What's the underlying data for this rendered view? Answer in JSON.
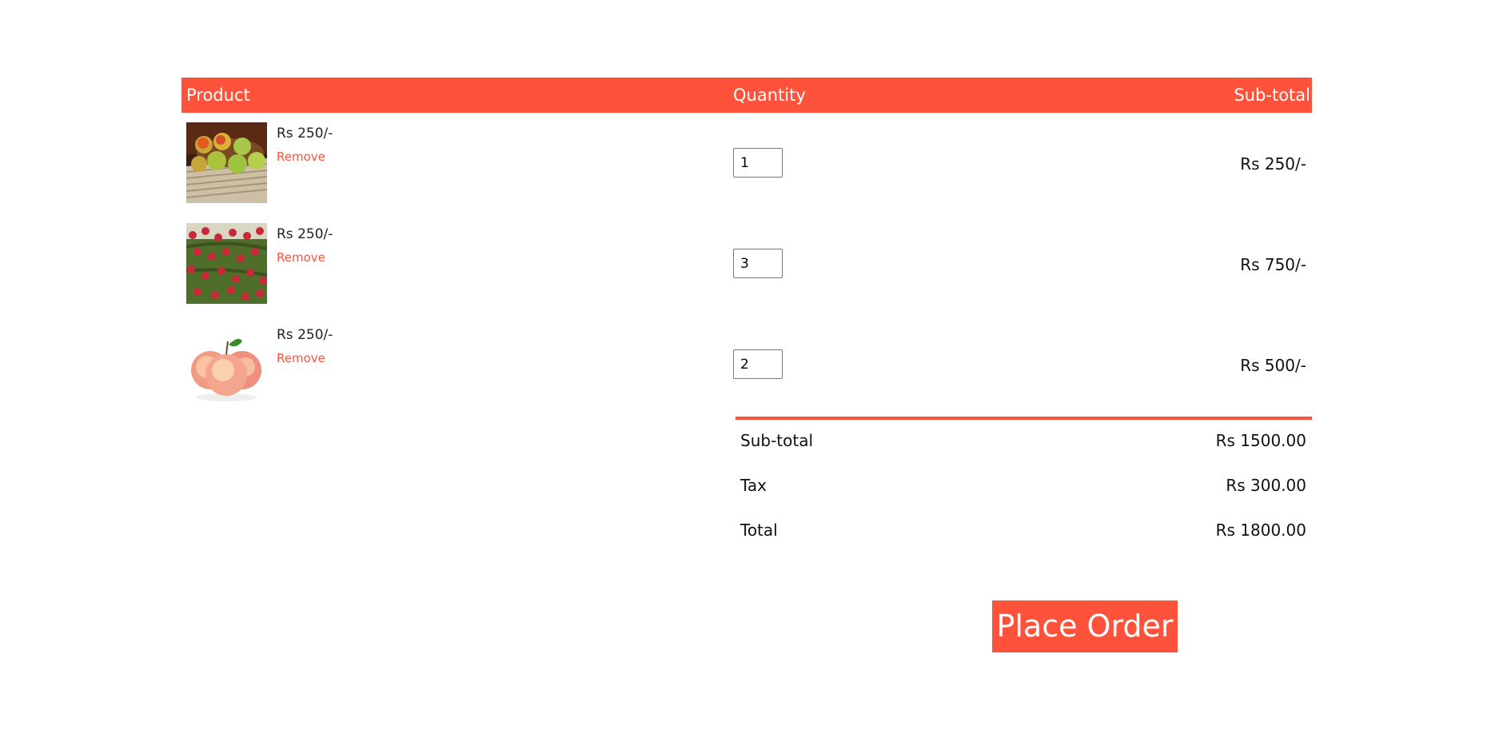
{
  "header": {
    "product": "Product",
    "quantity": "Quantity",
    "subtotal": "Sub-total"
  },
  "items": [
    {
      "image": "green-apples-in-basket-image",
      "price": "Rs 250/-",
      "remove": "Remove",
      "quantity": "1",
      "subtotal": "Rs 250/-"
    },
    {
      "image": "apple-tree-image",
      "price": "Rs 250/-",
      "remove": "Remove",
      "quantity": "3",
      "subtotal": "Rs 750/-"
    },
    {
      "image": "red-apples-image",
      "price": "Rs 250/-",
      "remove": "Remove",
      "quantity": "2",
      "subtotal": "Rs 500/-"
    }
  ],
  "totals": {
    "subtotal_label": "Sub-total",
    "subtotal_value": "Rs 1500.00",
    "tax_label": "Tax",
    "tax_value": "Rs 300.00",
    "total_label": "Total",
    "total_value": "Rs 1800.00"
  },
  "actions": {
    "place_order": "Place Order"
  },
  "colors": {
    "accent": "#ff523b"
  }
}
